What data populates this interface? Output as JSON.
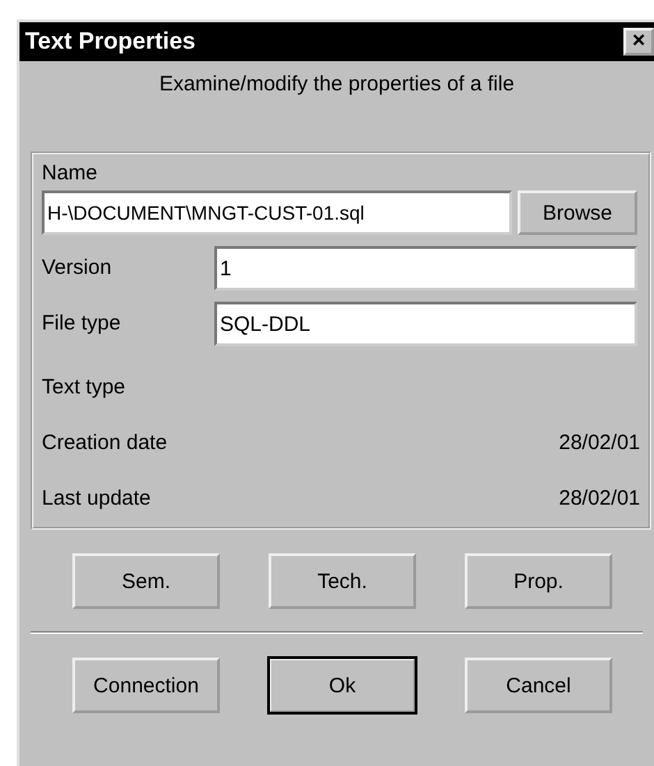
{
  "window": {
    "title": "Text Properties",
    "close": "×"
  },
  "description": "Examine/modify the properties of a file",
  "name_field": {
    "label": "Name",
    "value": "H-\\DOCUMENT\\MNGT-CUST-01.sql",
    "button": "Browse"
  },
  "fields": [
    {
      "label": "Version",
      "value": "1"
    },
    {
      "label": "File type",
      "value": "SQL-DDL"
    }
  ],
  "info": [
    {
      "label": "Text type"
    },
    {
      "label": "Creation date",
      "value": "28/02/01"
    },
    {
      "label": "Last update",
      "value": "28/02/01"
    }
  ],
  "view_buttons": [
    {
      "label": "Sem.",
      "default": false
    },
    {
      "label": "Tech.",
      "default": false
    },
    {
      "label": "Prop.",
      "default": false
    }
  ],
  "action_buttons": [
    {
      "label": "Connection",
      "default": false
    },
    {
      "label": "Ok",
      "default": true
    },
    {
      "label": "Cancel",
      "default": false
    }
  ]
}
